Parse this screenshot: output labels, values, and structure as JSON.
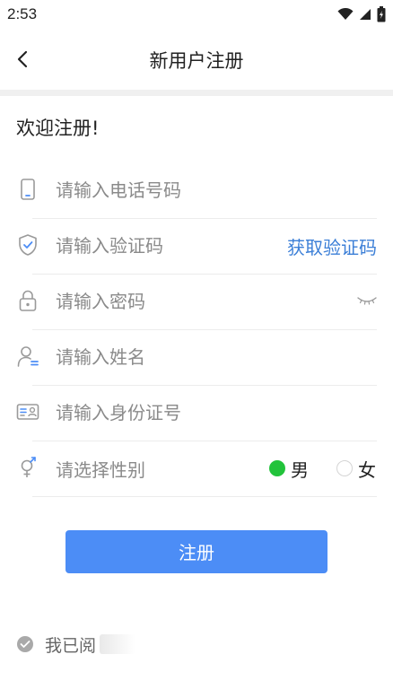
{
  "status_bar": {
    "time": "2:53",
    "icons": [
      "wifi-icon",
      "signal-icon",
      "battery-icon"
    ]
  },
  "header": {
    "back_icon": "chevron-left-icon",
    "title": "新用户注册"
  },
  "welcome_text": "欢迎注册!",
  "form": {
    "phone": {
      "placeholder": "请输入电话号码",
      "value": "",
      "icon": "phone-icon"
    },
    "code": {
      "placeholder": "请输入验证码",
      "value": "",
      "icon": "shield-check-icon",
      "get_code_label": "获取验证码"
    },
    "password": {
      "placeholder": "请输入密码",
      "value": "",
      "icon": "lock-icon",
      "toggle_icon": "eye-closed-icon"
    },
    "name": {
      "placeholder": "请输入姓名",
      "value": "",
      "icon": "user-icon"
    },
    "id_number": {
      "placeholder": "请输入身份证号",
      "value": "",
      "icon": "id-card-icon"
    },
    "gender": {
      "label": "请选择性别",
      "icon": "gender-icon",
      "options": [
        {
          "label": "男",
          "selected": true
        },
        {
          "label": "女",
          "selected": false
        }
      ]
    }
  },
  "register_button": {
    "label": "注册"
  },
  "agreement": {
    "text": "我已阅"
  },
  "colors": {
    "accent": "#4c8df6",
    "link": "#3c7fd7",
    "radio_on": "#22c33b",
    "placeholder": "#8a8a8a"
  }
}
